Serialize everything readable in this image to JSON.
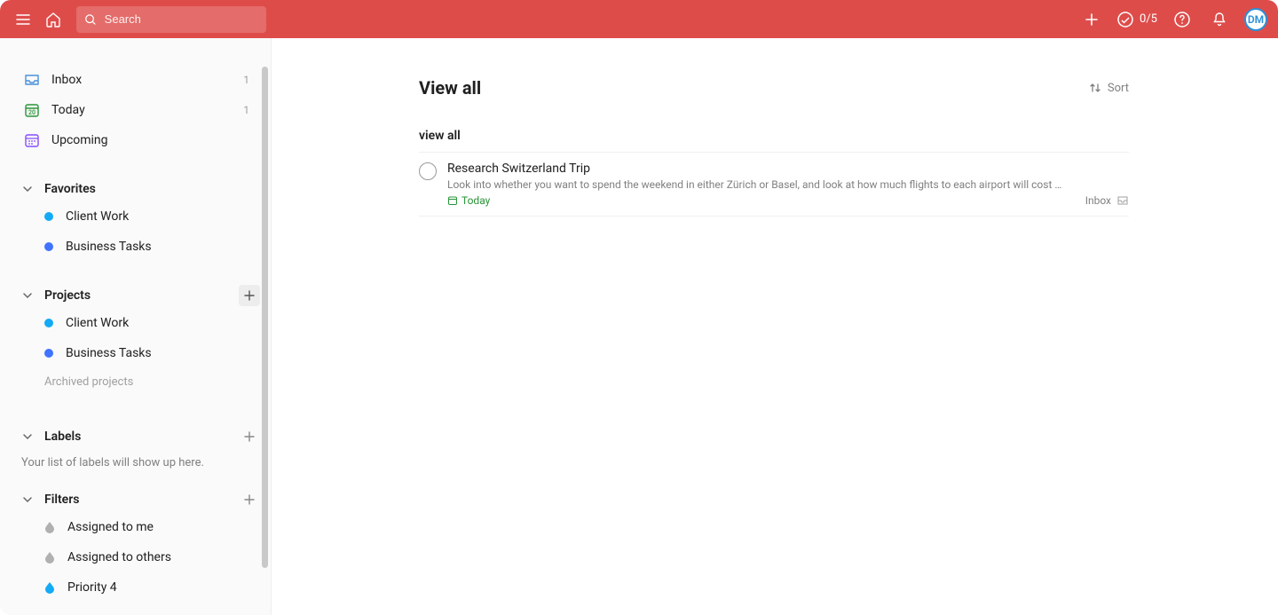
{
  "header": {
    "search_placeholder": "Search",
    "productivity_count": "0/5",
    "avatar_initials": "DM"
  },
  "sidebar": {
    "nav": [
      {
        "key": "inbox",
        "label": "Inbox",
        "count": "1"
      },
      {
        "key": "today",
        "label": "Today",
        "count": "1",
        "day": "20"
      },
      {
        "key": "upcoming",
        "label": "Upcoming",
        "count": ""
      }
    ],
    "favorites": {
      "title": "Favorites",
      "items": [
        {
          "label": "Client Work",
          "color": "#14aaf5"
        },
        {
          "label": "Business Tasks",
          "color": "#4073ff"
        }
      ]
    },
    "projects": {
      "title": "Projects",
      "items": [
        {
          "label": "Client Work",
          "color": "#14aaf5"
        },
        {
          "label": "Business Tasks",
          "color": "#4073ff"
        }
      ],
      "archived_label": "Archived projects"
    },
    "labels": {
      "title": "Labels",
      "empty_text": "Your list of labels will show up here."
    },
    "filters": {
      "title": "Filters",
      "items": [
        {
          "label": "Assigned to me",
          "color": "grey"
        },
        {
          "label": "Assigned to others",
          "color": "grey"
        },
        {
          "label": "Priority 4",
          "color": "blue"
        }
      ]
    }
  },
  "main": {
    "title": "View all",
    "sort_label": "Sort",
    "section_label": "view all",
    "tasks": [
      {
        "title": "Research Switzerland Trip",
        "description": "Look into whether you want to spend the weekend in either Zürich or Basel, and look at how much flights to each airport will cost …",
        "due": "Today",
        "project": "Inbox"
      }
    ]
  }
}
